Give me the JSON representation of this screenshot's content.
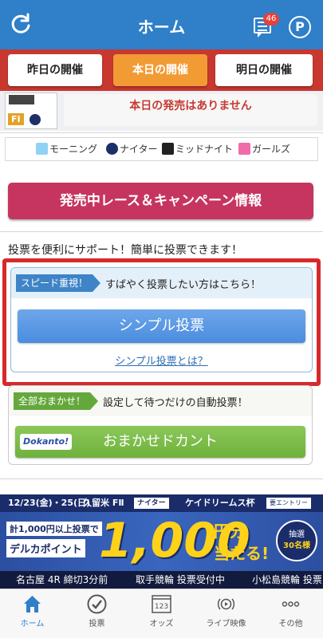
{
  "header": {
    "title": "ホーム",
    "badge_count": "46",
    "p_label": "P",
    "icons": [
      "refresh-icon",
      "message-icon",
      "point-icon"
    ]
  },
  "day_tabs": [
    {
      "label": "昨日の開催"
    },
    {
      "label": "本日の開催",
      "selected": true
    },
    {
      "label": "明日の開催"
    }
  ],
  "venue": {
    "logo_badge": "FI",
    "notice": "本日の発売はありません"
  },
  "legend": [
    {
      "label": "モーニング",
      "color": "#8fd3f4"
    },
    {
      "label": "ナイター",
      "color": "#1d2f66"
    },
    {
      "label": "ミッドナイト",
      "color": "#222222"
    },
    {
      "label": "ガールズ",
      "color": "#f06ca8"
    }
  ],
  "campaign_button": "発売中レース＆キャンペーン情報",
  "support_text": "投票を便利にサポート！簡単に投票できます！",
  "simple": {
    "tag": "スピード重視！",
    "desc": "すばやく投票したい方はこちら！",
    "button": "シンプル投票",
    "link": "シンプル投票とは？"
  },
  "auto": {
    "tag": "全部おまかせ！",
    "desc": "設定して待つだけの自動投票！",
    "logo": "Dokanto!",
    "button": "おまかせドカント"
  },
  "banner": {
    "date": "12/23(金)・25(日)",
    "venue": "久留米 FⅡ",
    "night": "ナイター",
    "cup": "ケイドリームス杯",
    "entry": "要エントリー",
    "left1": "計1,000円以上投票で",
    "left2": "デルカポイント",
    "amount": "1,000",
    "yen": "円分",
    "hit": "当たる!",
    "lottery_line1": "抽選",
    "lottery_line2": "30名様"
  },
  "ticker": [
    "名古屋 4R 締切3分前",
    "取手競輪 投票受付中",
    "小松島競輪 投票"
  ],
  "tabbar": [
    {
      "label": "ホーム",
      "icon": "home-icon",
      "active": true
    },
    {
      "label": "投票",
      "icon": "check-circle-icon"
    },
    {
      "label": "オッズ",
      "icon": "odds-icon",
      "icon_text": "123"
    },
    {
      "label": "ライブ映像",
      "icon": "live-video-icon"
    },
    {
      "label": "その他",
      "icon": "more-icon"
    }
  ],
  "colors": {
    "header": "#2f7fc9",
    "day_tab_bar": "#c8382f",
    "day_tab_selected": "#f29b35",
    "campaign": "#c63560",
    "highlight_border": "#d7292b",
    "simple_button": "#4a8ddf",
    "auto_button": "#6fb13d"
  }
}
